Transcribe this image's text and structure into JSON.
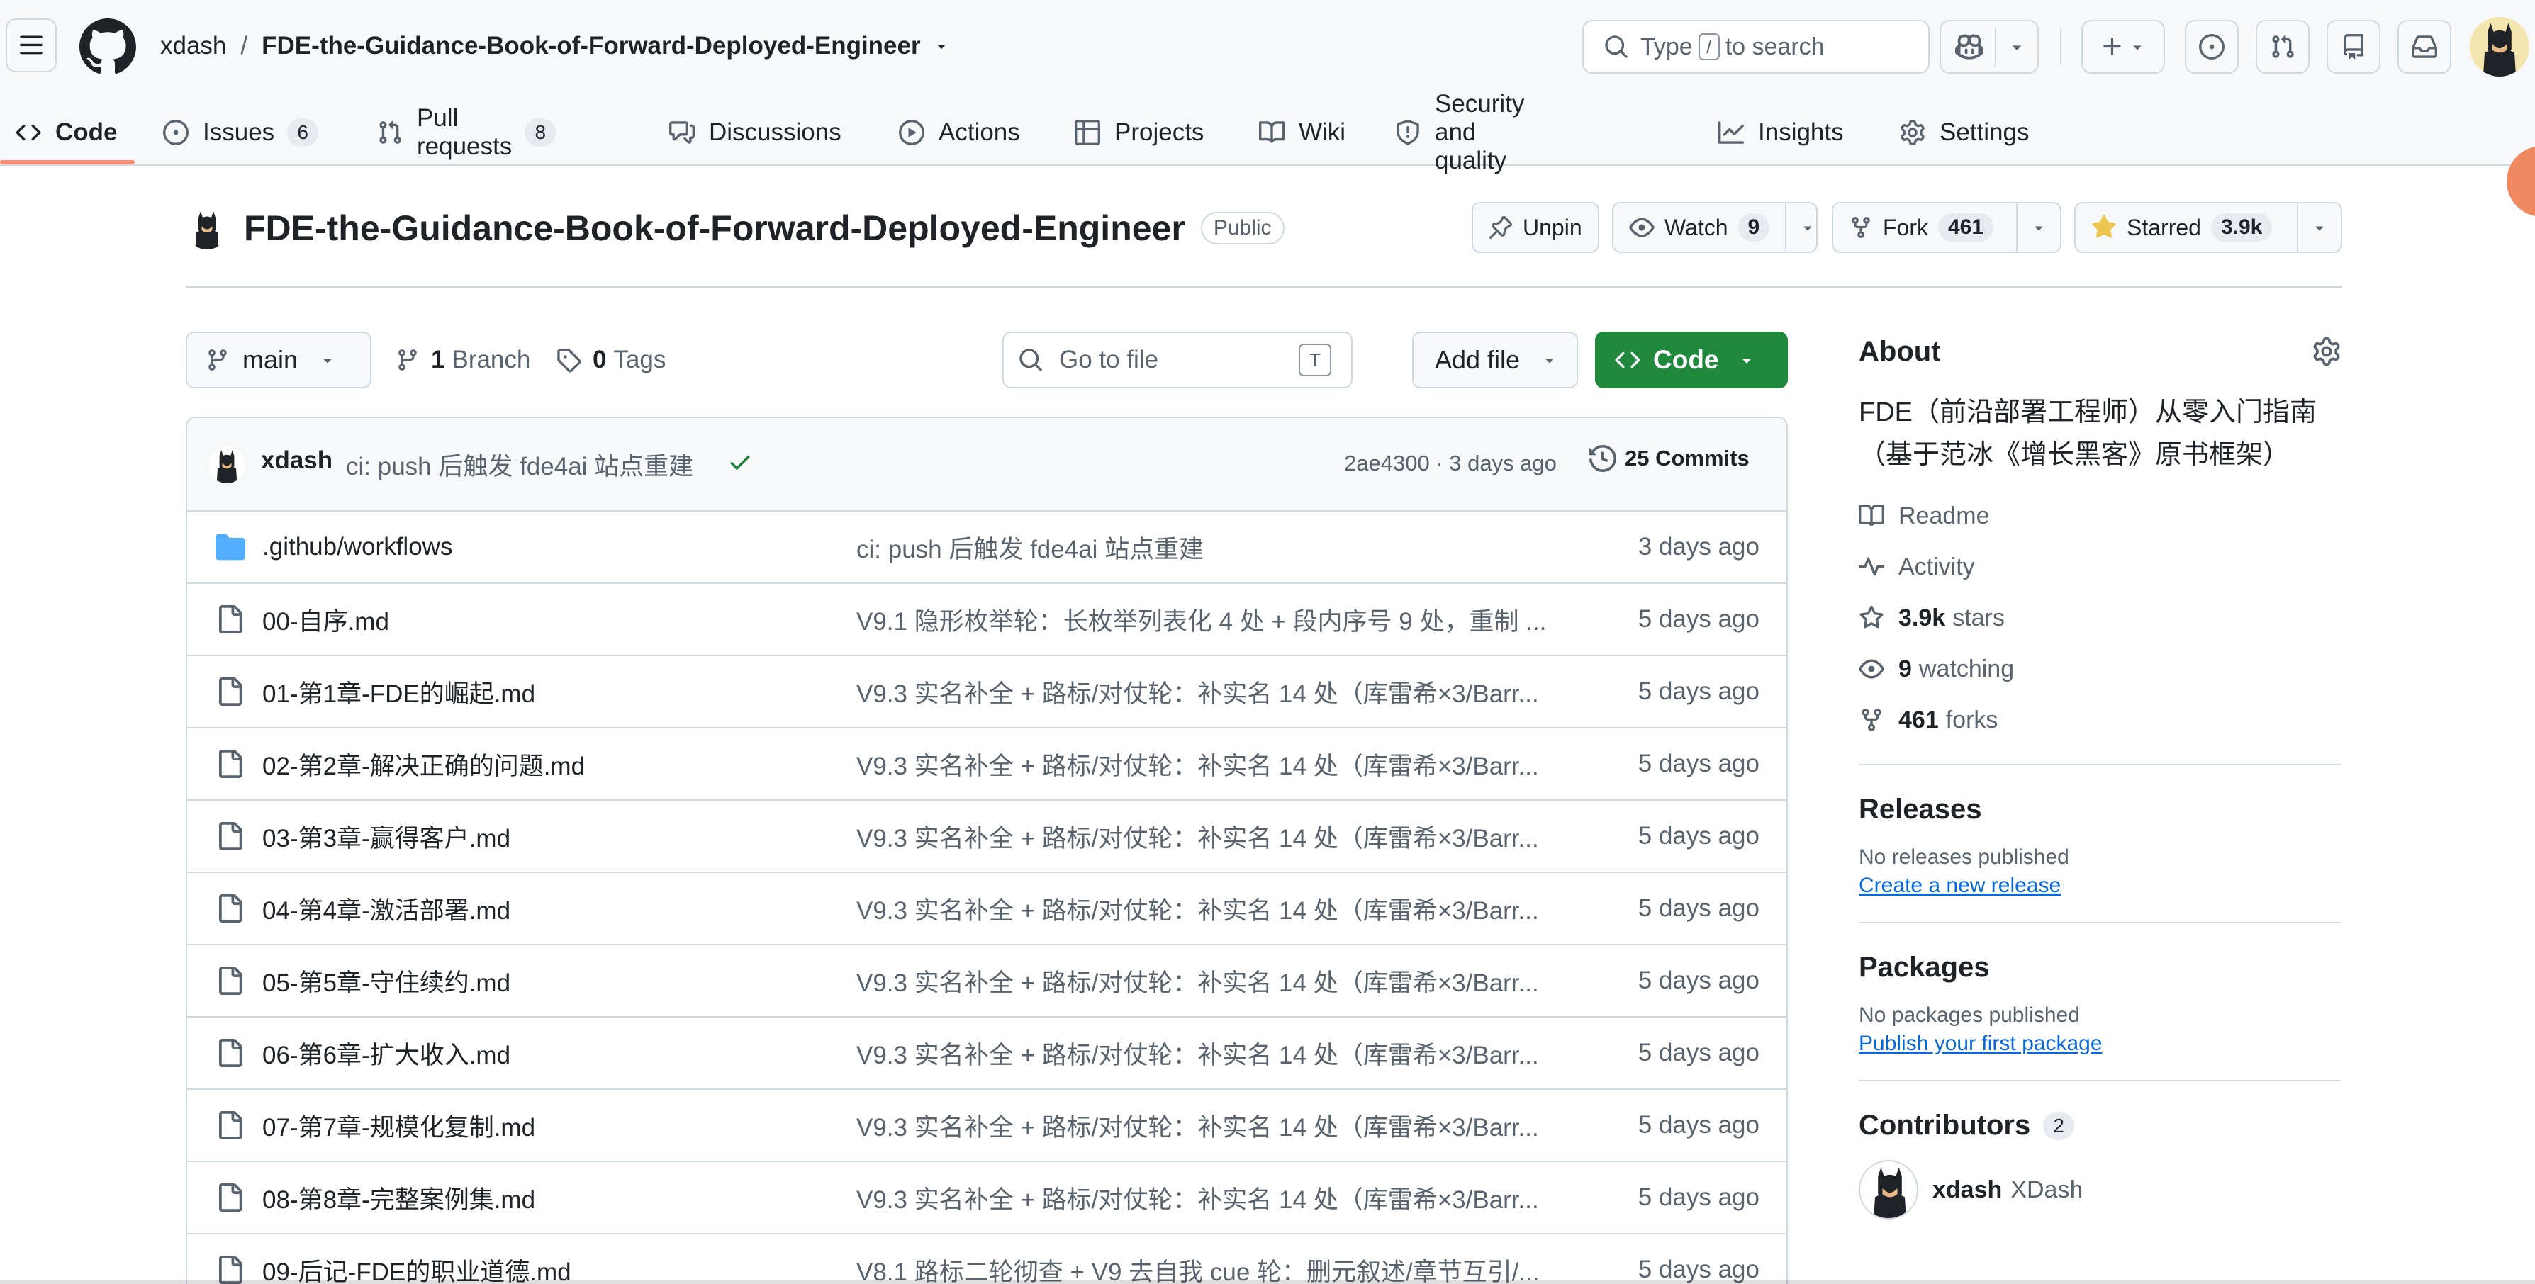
{
  "header": {
    "owner": "xdash",
    "separator": "/",
    "repo": "FDE-the-Guidance-Book-of-Forward-Deployed-Engineer",
    "search_type": "Type",
    "search_key": "/",
    "search_suffix": "to search"
  },
  "tabs": [
    {
      "label": "Code",
      "icon": "code-icon",
      "count": ""
    },
    {
      "label": "Issues",
      "icon": "issue-icon",
      "count": "6"
    },
    {
      "label": "Pull requests",
      "icon": "pull-request-icon",
      "count": "8"
    },
    {
      "label": "Discussions",
      "icon": "discussions-icon",
      "count": ""
    },
    {
      "label": "Actions",
      "icon": "play-icon",
      "count": ""
    },
    {
      "label": "Projects",
      "icon": "table-icon",
      "count": ""
    },
    {
      "label": "Wiki",
      "icon": "book-icon",
      "count": ""
    },
    {
      "label": "Security and quality",
      "icon": "shield-icon",
      "count": ""
    },
    {
      "label": "Insights",
      "icon": "graph-icon",
      "count": ""
    },
    {
      "label": "Settings",
      "icon": "gear-icon",
      "count": ""
    }
  ],
  "repo_header": {
    "name": "FDE-the-Guidance-Book-of-Forward-Deployed-Engineer",
    "visibility": "Public",
    "unpin": "Unpin",
    "watch": "Watch",
    "watch_count": "9",
    "fork": "Fork",
    "fork_count": "461",
    "starred": "Starred",
    "star_count": "3.9k"
  },
  "toolbar": {
    "branch": "main",
    "branch_count": "1",
    "branch_label": "Branch",
    "tag_count": "0",
    "tag_label": "Tags",
    "goto_placeholder": "Go to file",
    "goto_key": "T",
    "add_file": "Add file",
    "code": "Code"
  },
  "latest_commit": {
    "author": "xdash",
    "message": "ci: push 后触发 fde4ai 站点重建",
    "sha_time": "2ae4300 · 3 days ago",
    "commits": "25 Commits"
  },
  "files": [
    {
      "name": ".github/workflows",
      "type": "folder",
      "message": "ci: push 后触发 fde4ai 站点重建",
      "date": "3 days ago"
    },
    {
      "name": "00-自序.md",
      "type": "file",
      "message": "V9.1 隐形枚举轮：长枚举列表化 4 处 + 段内序号 9 处，重制 ...",
      "date": "5 days ago"
    },
    {
      "name": "01-第1章-FDE的崛起.md",
      "type": "file",
      "message": "V9.3 实名补全 + 路标/对仗轮：补实名 14 处（库雷希×3/Barr...",
      "date": "5 days ago"
    },
    {
      "name": "02-第2章-解决正确的问题.md",
      "type": "file",
      "message": "V9.3 实名补全 + 路标/对仗轮：补实名 14 处（库雷希×3/Barr...",
      "date": "5 days ago"
    },
    {
      "name": "03-第3章-赢得客户.md",
      "type": "file",
      "message": "V9.3 实名补全 + 路标/对仗轮：补实名 14 处（库雷希×3/Barr...",
      "date": "5 days ago"
    },
    {
      "name": "04-第4章-激活部署.md",
      "type": "file",
      "message": "V9.3 实名补全 + 路标/对仗轮：补实名 14 处（库雷希×3/Barr...",
      "date": "5 days ago"
    },
    {
      "name": "05-第5章-守住续约.md",
      "type": "file",
      "message": "V9.3 实名补全 + 路标/对仗轮：补实名 14 处（库雷希×3/Barr...",
      "date": "5 days ago"
    },
    {
      "name": "06-第6章-扩大收入.md",
      "type": "file",
      "message": "V9.3 实名补全 + 路标/对仗轮：补实名 14 处（库雷希×3/Barr...",
      "date": "5 days ago"
    },
    {
      "name": "07-第7章-规模化复制.md",
      "type": "file",
      "message": "V9.3 实名补全 + 路标/对仗轮：补实名 14 处（库雷希×3/Barr...",
      "date": "5 days ago"
    },
    {
      "name": "08-第8章-完整案例集.md",
      "type": "file",
      "message": "V9.3 实名补全 + 路标/对仗轮：补实名 14 处（库雷希×3/Barr...",
      "date": "5 days ago"
    },
    {
      "name": "09-后记-FDE的职业道德.md",
      "type": "file",
      "message": "V8.1 路标二轮彻查 + V9 去自我 cue 轮：删元叙述/章节互引/...",
      "date": "5 days ago"
    }
  ],
  "about": {
    "title": "About",
    "description_line1": "FDE（前沿部署工程师）从零入门指南",
    "description_line2": "（基于范冰《增长黑客》原书框架）",
    "readme": "Readme",
    "activity": "Activity",
    "stars_count": "3.9k",
    "stars_label": "stars",
    "watching_count": "9",
    "watching_label": "watching",
    "forks_count": "461",
    "forks_label": "forks"
  },
  "releases": {
    "title": "Releases",
    "empty": "No releases published",
    "link": "Create a new release"
  },
  "packages": {
    "title": "Packages",
    "empty": "No packages published",
    "link": "Publish your first package"
  },
  "contributors": {
    "title": "Contributors",
    "count": "2",
    "login": "xdash",
    "name": "XDash"
  },
  "colors": {
    "accent_green": "#1f883d",
    "link_blue": "#0969da",
    "tab_underline": "#fd8c73",
    "star_yellow": "#eac54f",
    "folder_blue": "#54aeff"
  }
}
